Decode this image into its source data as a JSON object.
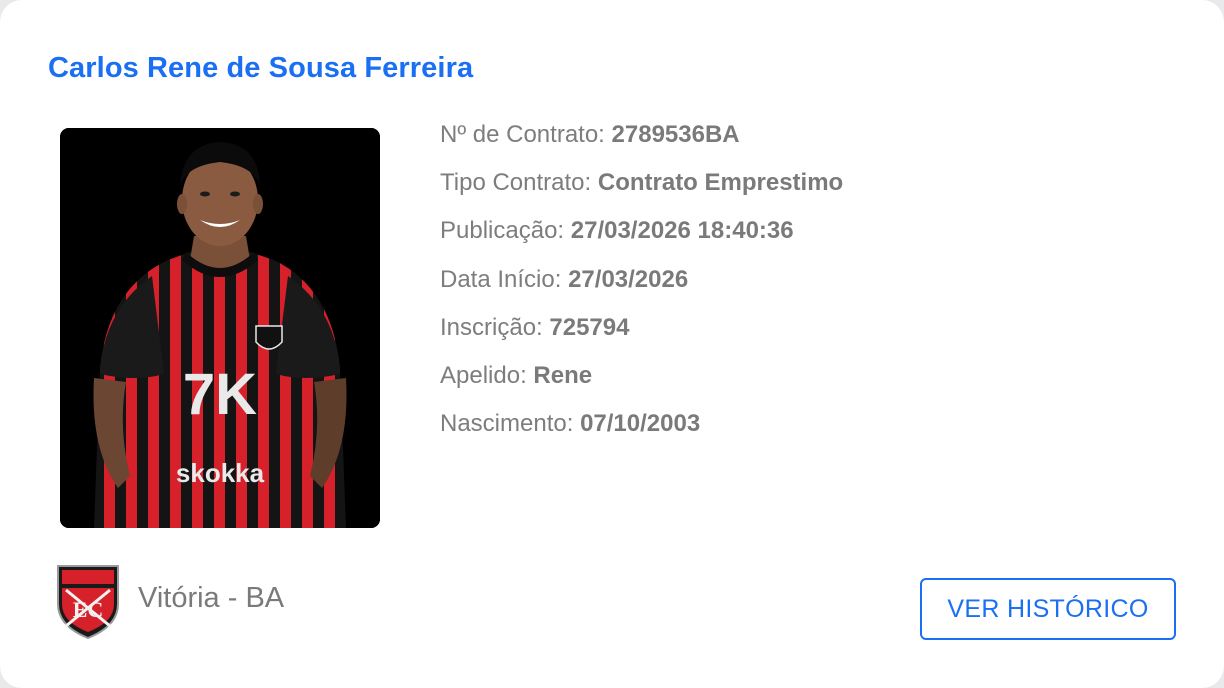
{
  "player": {
    "name": "Carlos Rene de Sousa Ferreira",
    "photo_alt": "Carlos Rene de Sousa Ferreira"
  },
  "details": [
    {
      "label": "Nº de Contrato:",
      "value": "2789536BA"
    },
    {
      "label": "Tipo Contrato:",
      "value": "Contrato Emprestimo"
    },
    {
      "label": "Publicação:",
      "value": "27/03/2026 18:40:36"
    },
    {
      "label": "Data Início:",
      "value": "27/03/2026"
    },
    {
      "label": "Inscrição:",
      "value": "725794"
    },
    {
      "label": "Apelido:",
      "value": "Rene"
    },
    {
      "label": "Nascimento:",
      "value": "07/10/2003"
    }
  ],
  "club": {
    "name": "Vitória - BA",
    "logo_icon": "vitoria-crest-icon"
  },
  "actions": {
    "history_label": "VER HISTÓRICO"
  },
  "colors": {
    "accent": "#1a6ff2",
    "text_muted": "#7d7d7d",
    "jersey_red": "#d6202a",
    "jersey_black": "#111111"
  }
}
